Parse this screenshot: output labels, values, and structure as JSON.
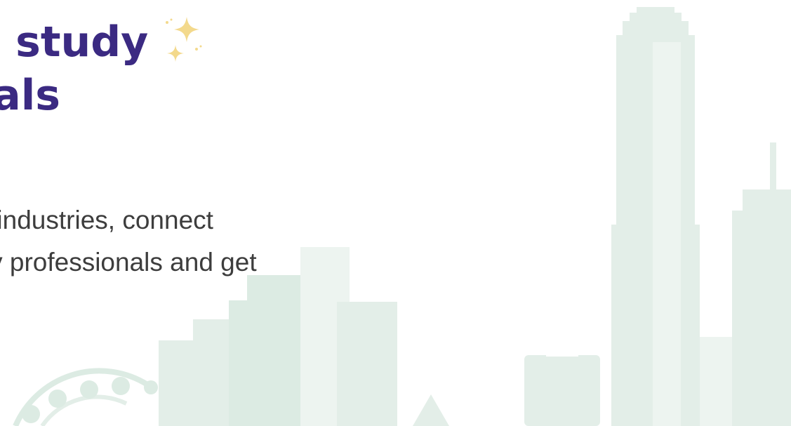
{
  "hero": {
    "headline_line_1": "o study",
    "headline_line_2": "oals",
    "body_line_1": "nd industries, connect",
    "body_line_2": "stry professionals and get"
  },
  "icons": {
    "sparkle": "sparkle-icon"
  },
  "colors": {
    "headline": "#3b2a82",
    "body_text": "#3d3d3d",
    "sparkle": "#f3d98c",
    "skyline": "#e3eee8",
    "skyline_light": "#edf4f0"
  }
}
